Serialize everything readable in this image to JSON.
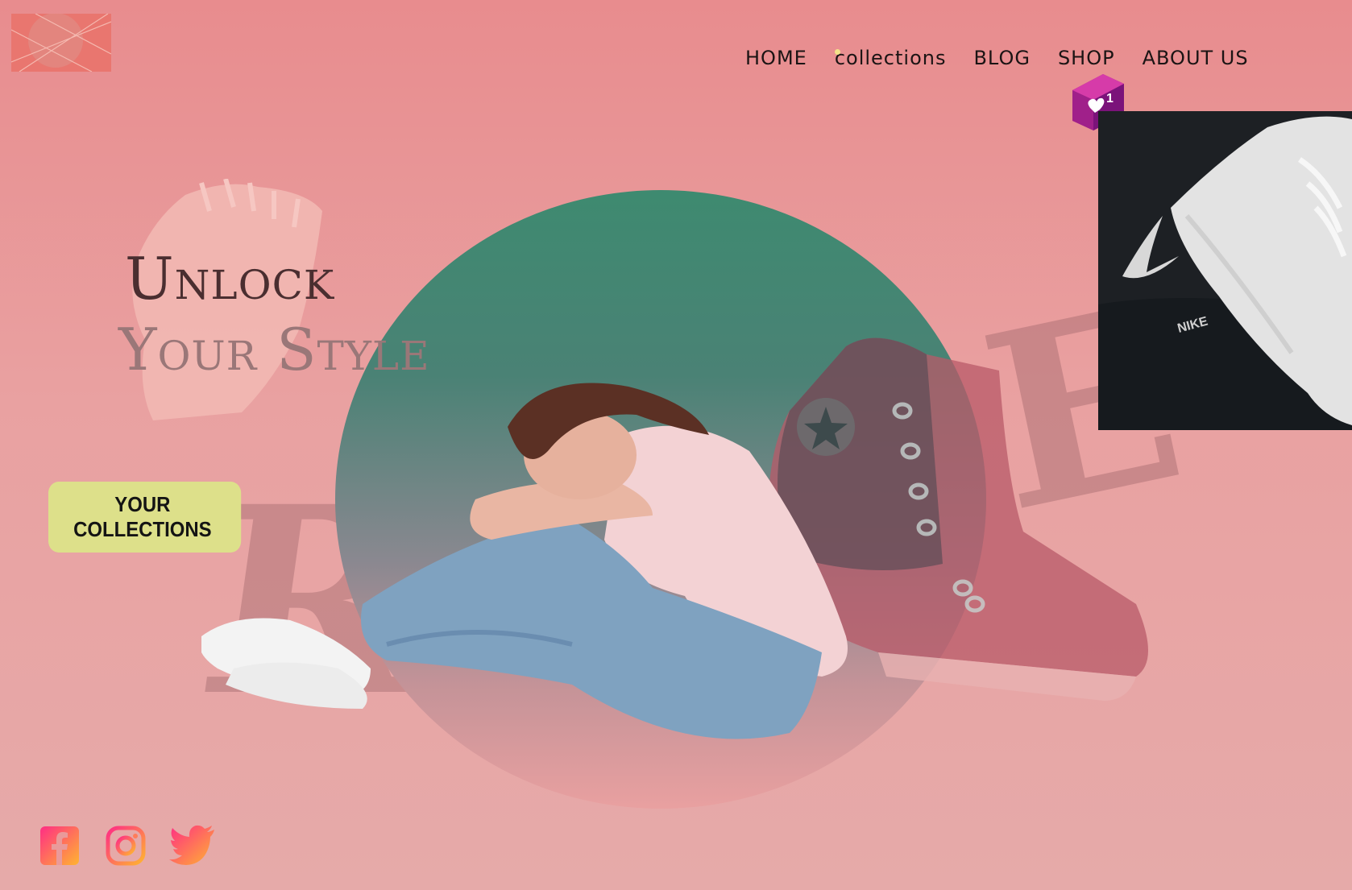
{
  "nav": {
    "items": [
      {
        "label": "HOME"
      },
      {
        "label": "collections"
      },
      {
        "label": "BLOG"
      },
      {
        "label": "SHOP"
      },
      {
        "label": "ABOUT US"
      }
    ],
    "active_index": 1
  },
  "notification": {
    "count": "1",
    "icon": "heart-icon"
  },
  "hero": {
    "line1": "Unlock",
    "line2": "Your Style",
    "background_letters": "R    E"
  },
  "cta": {
    "label": "YOUR COLLECTIONS"
  },
  "colors": {
    "background": "#e88c8e",
    "circle_green": "#3e8a70",
    "cta": "#dde08a",
    "headline_dark": "#4a2e30",
    "headline_light": "#9a7778"
  },
  "social": {
    "icons": [
      "facebook-icon",
      "instagram-icon",
      "twitter-icon"
    ]
  }
}
